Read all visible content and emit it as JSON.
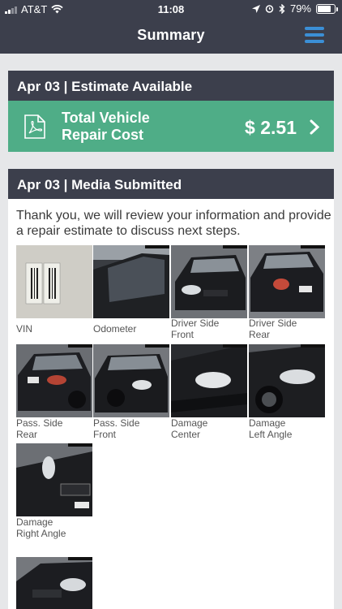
{
  "status_bar": {
    "carrier": "AT&T",
    "time": "11:08",
    "battery": "79%",
    "battery_level": 0.79
  },
  "nav": {
    "title": "Summary",
    "menu_icon": "hamburger-menu-icon"
  },
  "estimate_card": {
    "header": "Apr 03 | Estimate Available",
    "icon": "pdf-icon",
    "label_line1": "Total Vehicle",
    "label_line2": "Repair Cost",
    "amount": "$ 2.51",
    "chevron_icon": "chevron-right-icon"
  },
  "media_card": {
    "header": "Apr 03 | Media Submitted",
    "message": "Thank you, we will review your information and provide a repair estimate to discuss next steps.",
    "photos": [
      {
        "label1": "VIN",
        "label2": ""
      },
      {
        "label1": "Odometer",
        "label2": ""
      },
      {
        "label1": "Driver Side",
        "label2": "Front"
      },
      {
        "label1": "Driver Side",
        "label2": "Rear"
      },
      {
        "label1": "Pass. Side",
        "label2": "Rear"
      },
      {
        "label1": "Pass. Side",
        "label2": "Front"
      },
      {
        "label1": "Damage",
        "label2": "Center"
      },
      {
        "label1": "Damage",
        "label2": "Left Angle"
      },
      {
        "label1": "Damage",
        "label2": "Right Angle"
      },
      {
        "label1": "",
        "label2": ""
      }
    ]
  },
  "colors": {
    "header_bg": "#3c3f4c",
    "estimate_green": "#4fad87",
    "menu_blue": "#3b8fd6",
    "page_bg": "#e6e7e9"
  }
}
